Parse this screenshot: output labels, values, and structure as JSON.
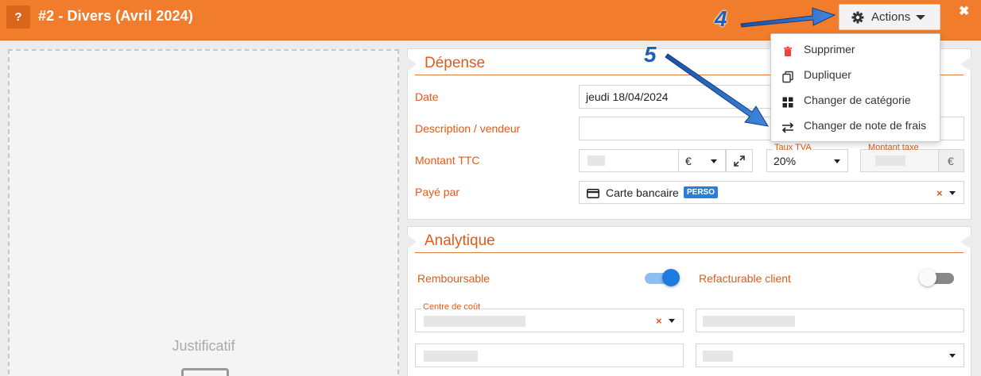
{
  "header": {
    "help_label": "?",
    "title": "#2 -  Divers (Avril 2024)",
    "actions_label": "Actions",
    "close_label": "✖"
  },
  "justificatif": {
    "label": "Justificatif"
  },
  "depense": {
    "title": "Dépense",
    "date_label": "Date",
    "date_value": "jeudi 18/04/2024",
    "description_label": "Description / vendeur",
    "description_value": "",
    "montant_label": "Montant TTC",
    "currency_value": "€",
    "taux_tva_label": "Taux TVA",
    "taux_tva_value": "20%",
    "montant_taxe_label": "Montant taxe",
    "montant_taxe_unit": "€",
    "paye_par_label": "Payé par",
    "paye_par_value": "Carte bancaire",
    "paye_par_badge": "PERSO"
  },
  "analytique": {
    "title": "Analytique",
    "remboursable_label": "Remboursable",
    "remboursable_on": true,
    "refacturable_label": "Refacturable client",
    "refacturable_on": false,
    "centre_cout_label": "Centre de coût"
  },
  "actions_menu": {
    "items": [
      {
        "label": "Supprimer",
        "icon": "trash-icon"
      },
      {
        "label": "Dupliquer",
        "icon": "duplicate-icon"
      },
      {
        "label": "Changer de catégorie",
        "icon": "grid-icon"
      },
      {
        "label": "Changer de note de frais",
        "icon": "swap-arrows-icon"
      }
    ]
  },
  "annotations": {
    "step_4": "4",
    "step_5": "5"
  },
  "colors": {
    "header_orange": "#f07c2c",
    "label_orange": "#e05a1a",
    "annotation_blue": "#1f5fb4",
    "toggle_blue": "#1e7be0"
  }
}
